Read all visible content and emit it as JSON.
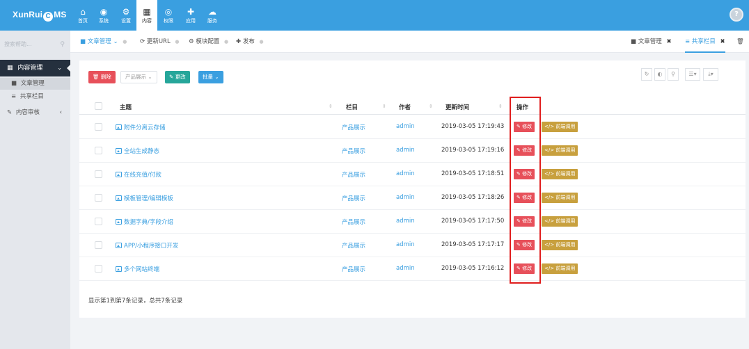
{
  "topbar": {
    "logo_left": "XunRui",
    "logo_o": "C",
    "logo_right": "MS",
    "nav": [
      {
        "label": "首页",
        "icon": "home-icon",
        "glyph": "⌂"
      },
      {
        "label": "系统",
        "icon": "globe-icon",
        "glyph": "◉"
      },
      {
        "label": "设置",
        "icon": "gears-icon",
        "glyph": "⚙"
      },
      {
        "label": "内容",
        "icon": "grid-icon",
        "glyph": "▦"
      },
      {
        "label": "权限",
        "icon": "user-circle-icon",
        "glyph": "◎"
      },
      {
        "label": "应用",
        "icon": "puzzle-icon",
        "glyph": "✚"
      },
      {
        "label": "服务",
        "icon": "cloud-icon",
        "glyph": "☁"
      }
    ],
    "active_nav": "内容",
    "help_glyph": "?"
  },
  "sidebar": {
    "search_placeholder": "搜索帮助...",
    "search_glyph": "⚲",
    "group_label": "内容管理",
    "group_glyph": "▦",
    "group_chevron": "⌄",
    "items": [
      {
        "label": "文章管理",
        "glyph": "■"
      },
      {
        "label": "共享栏目",
        "glyph": "≡"
      }
    ],
    "audit_label": "内容审核",
    "audit_glyph": "✎",
    "audit_chevron": "‹"
  },
  "tabs": {
    "left": [
      {
        "label": "文章管理",
        "glyph": "■",
        "suffix": "⌄"
      },
      {
        "label": "更新URL",
        "glyph": "⟳"
      },
      {
        "label": "模块配置",
        "glyph": "⚙"
      },
      {
        "label": "发布",
        "glyph": "✚"
      }
    ],
    "dot": "●",
    "right": [
      {
        "label": "文章管理",
        "glyph": "■",
        "close": "✖"
      },
      {
        "label": "共享栏目",
        "glyph": "≡",
        "close": "✖"
      }
    ],
    "trash_glyph": "🗑"
  },
  "toolbar": {
    "delete_label": "删除",
    "delete_glyph": "🗑",
    "category_label": "产品展示",
    "category_chevron": "⌄",
    "change_label": "更改",
    "change_glyph": "✎",
    "batch_label": "批量",
    "batch_chevron": "⌄",
    "tools": [
      {
        "name": "refresh",
        "glyph": "↻"
      },
      {
        "name": "toggle",
        "glyph": "◐"
      },
      {
        "name": "search",
        "glyph": "⚲"
      },
      {
        "name": "columns",
        "glyph": "☰▾"
      },
      {
        "name": "export",
        "glyph": "⤓▾"
      }
    ]
  },
  "table": {
    "headers": {
      "title": "主题",
      "category": "栏目",
      "author": "作者",
      "updated": "更新时间",
      "actions": "操作"
    },
    "sort_glyph": "⇕",
    "edit_label": "修改",
    "edit_glyph": "✎",
    "code_label": "前端调用",
    "code_glyph": "</>",
    "rows": [
      {
        "title": "附件分离云存储",
        "category": "产品展示",
        "author": "admin",
        "updated": "2019-03-05 17:19:43"
      },
      {
        "title": "全站生成静态",
        "category": "产品展示",
        "author": "admin",
        "updated": "2019-03-05 17:19:16"
      },
      {
        "title": "在线充值/付款",
        "category": "产品展示",
        "author": "admin",
        "updated": "2019-03-05 17:18:51"
      },
      {
        "title": "模板管理/编辑模板",
        "category": "产品展示",
        "author": "admin",
        "updated": "2019-03-05 17:18:26"
      },
      {
        "title": "数据字典/字段介绍",
        "category": "产品展示",
        "author": "admin",
        "updated": "2019-03-05 17:17:50"
      },
      {
        "title": "APP/小程序接口开发",
        "category": "产品展示",
        "author": "admin",
        "updated": "2019-03-05 17:17:17"
      },
      {
        "title": "多个网站终端",
        "category": "产品展示",
        "author": "admin",
        "updated": "2019-03-05 17:16:12"
      }
    ]
  },
  "footer": {
    "summary": "显示第1到第7条记录，总共7条记录"
  },
  "colors": {
    "brand": "#3a9fe0",
    "danger": "#e7505a",
    "success": "#26a69a",
    "warning": "#c8a03e",
    "highlight": "#e01e1e"
  }
}
